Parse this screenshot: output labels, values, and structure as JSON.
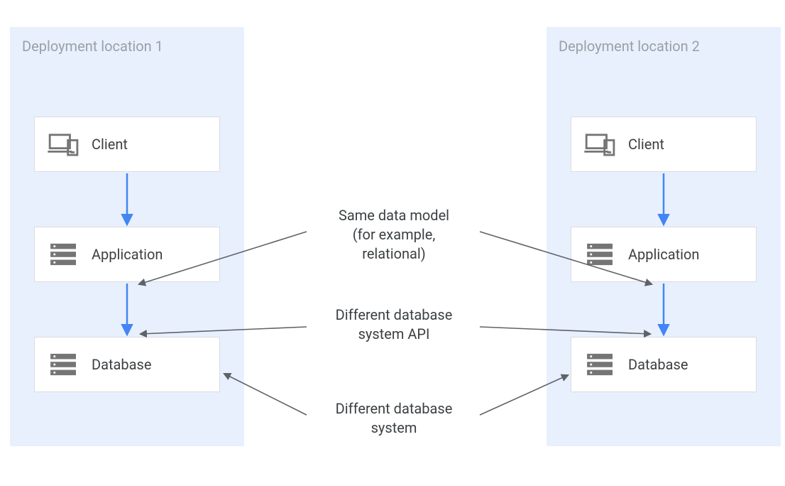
{
  "locations": {
    "left": {
      "title": "Deployment location 1"
    },
    "right": {
      "title": "Deployment location 2"
    }
  },
  "nodes": {
    "client": "Client",
    "application": "Application",
    "database": "Database"
  },
  "annotations": {
    "same_model": "Same data model\n(for example,\nrelational)",
    "diff_api": "Different database\nsystem API",
    "diff_system": "Different database\nsystem"
  },
  "colors": {
    "zone_bg": "#e8f0fe",
    "blue_arrow": "#4285f4",
    "dark_arrow": "#5f6368",
    "text_muted": "#9aa0a6"
  }
}
